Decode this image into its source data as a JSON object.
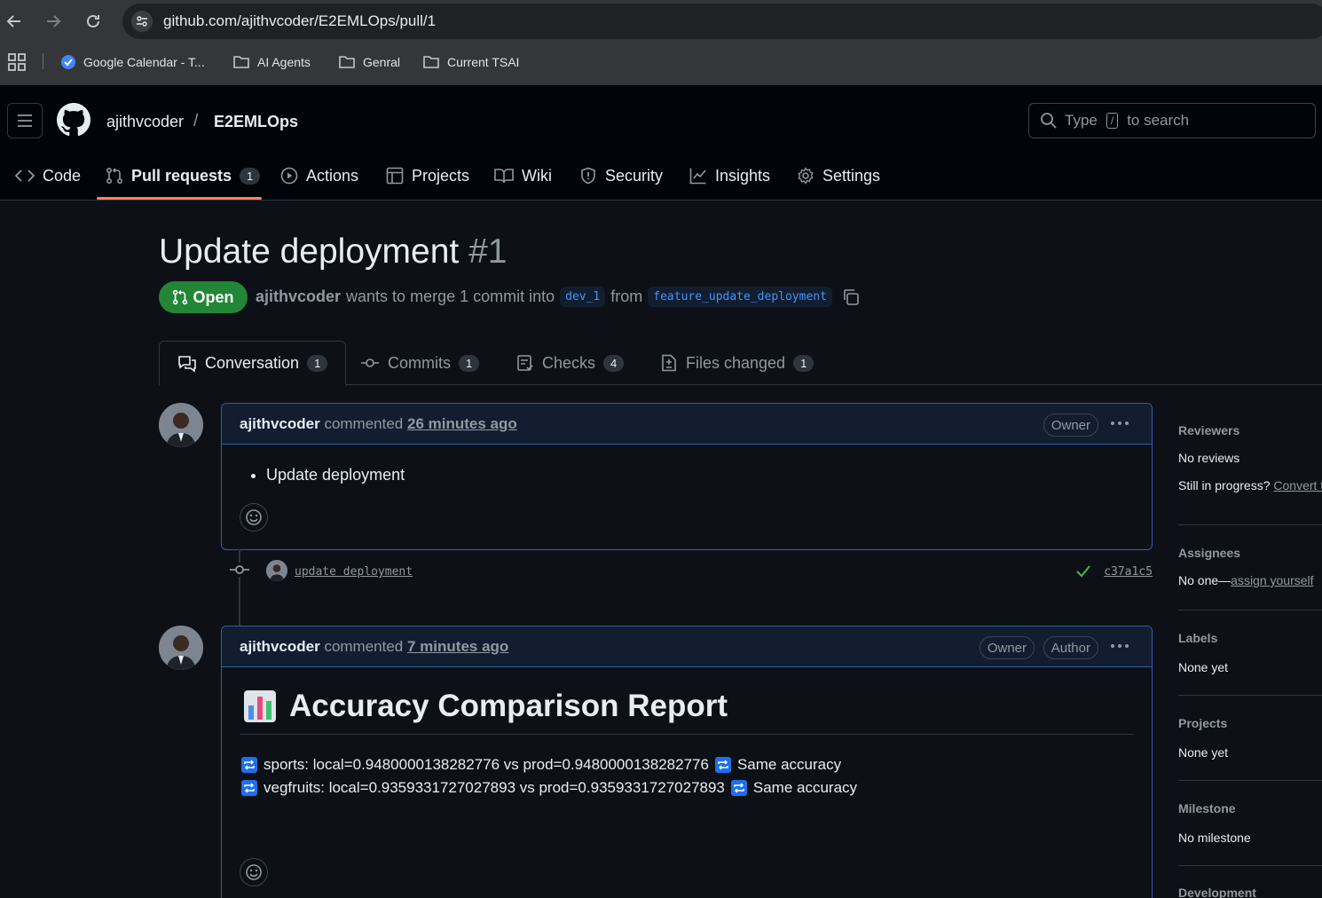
{
  "browser": {
    "url": "github.com/ajithvcoder/E2EMLOps/pull/1",
    "bookmarks": [
      {
        "label": "Google Calendar - T...",
        "icon": "google-calendar-icon"
      },
      {
        "label": "AI Agents",
        "icon": "folder-icon"
      },
      {
        "label": "Genral",
        "icon": "folder-icon"
      },
      {
        "label": "Current TSAI",
        "icon": "folder-icon"
      }
    ]
  },
  "header": {
    "owner": "ajithvcoder",
    "separator": "/",
    "repo": "E2EMLOps",
    "search": {
      "prefix": "Type",
      "key": "/",
      "suffix": "to search"
    }
  },
  "repo_tabs": [
    {
      "label": "Code",
      "icon": "code-icon"
    },
    {
      "label": "Pull requests",
      "icon": "git-pull-request-icon",
      "count": "1",
      "active": true
    },
    {
      "label": "Actions",
      "icon": "play-icon"
    },
    {
      "label": "Projects",
      "icon": "table-icon"
    },
    {
      "label": "Wiki",
      "icon": "book-icon"
    },
    {
      "label": "Security",
      "icon": "shield-icon"
    },
    {
      "label": "Insights",
      "icon": "graph-icon"
    },
    {
      "label": "Settings",
      "icon": "gear-icon"
    }
  ],
  "pr": {
    "title": "Update deployment",
    "number": "#1",
    "state": "Open",
    "author": "ajithvcoder",
    "merge_text": "wants to merge 1 commit into",
    "base_branch": "dev_1",
    "from_text": "from",
    "head_branch": "feature_update_deployment"
  },
  "pr_tabs": [
    {
      "label": "Conversation",
      "count": "1",
      "icon": "comment-discussion-icon",
      "active": true
    },
    {
      "label": "Commits",
      "count": "1",
      "icon": "git-commit-icon"
    },
    {
      "label": "Checks",
      "count": "4",
      "icon": "checklist-icon"
    },
    {
      "label": "Files changed",
      "count": "1",
      "icon": "file-diff-icon"
    }
  ],
  "comments": [
    {
      "author": "ajithvcoder",
      "action": "commented",
      "time": "26 minutes ago",
      "roles": [
        "Owner"
      ],
      "body_items": [
        "Update deployment"
      ]
    },
    {
      "author": "ajithvcoder",
      "action": "commented",
      "time": "7 minutes ago",
      "roles": [
        "Owner",
        "Author"
      ],
      "report_title": "Accuracy Comparison Report",
      "report_lines": [
        {
          "text": "sports: local=0.9480000138282776 vs prod=0.9480000138282776",
          "result": "Same accuracy"
        },
        {
          "text": "vegfruits: local=0.9359331727027893 vs prod=0.9359331727027893",
          "result": "Same accuracy"
        }
      ]
    }
  ],
  "commit": {
    "message": "update deployment",
    "sha": "c37a1c5",
    "status": "success"
  },
  "sidebar": {
    "reviewers": {
      "heading": "Reviewers",
      "value": "No reviews",
      "note": "Still in progress?",
      "note_link": "Convert to draft"
    },
    "assignees": {
      "heading": "Assignees",
      "value": "No one—",
      "link": "assign yourself"
    },
    "labels": {
      "heading": "Labels",
      "value": "None yet"
    },
    "projects": {
      "heading": "Projects",
      "value": "None yet"
    },
    "milestone": {
      "heading": "Milestone",
      "value": "No milestone"
    },
    "development": {
      "heading": "Development"
    }
  },
  "colors": {
    "open_green": "#238636",
    "accent_blue": "#4493f8",
    "tab_underline": "#f78166",
    "comment_border": "#2f5da8"
  }
}
